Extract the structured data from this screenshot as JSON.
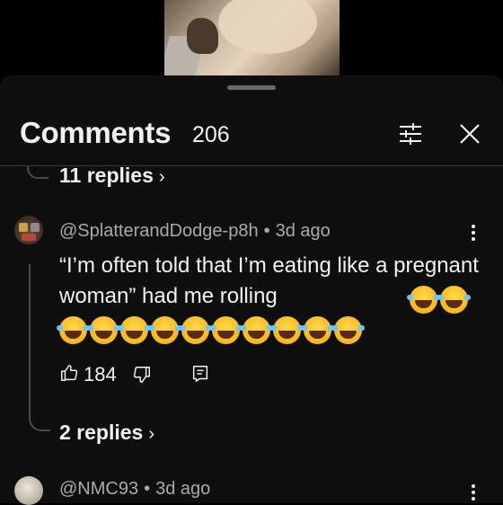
{
  "header": {
    "title": "Comments",
    "count": "206"
  },
  "thread_above": {
    "replies_label": "11 replies",
    "chevron": "›"
  },
  "comments": [
    {
      "author": "@SplatterandDodge-p8h",
      "time": "3d ago",
      "text": "“I’m often told that I’m eating like a pregnant woman” had me rolling",
      "emoji": "face-with-tears-of-joy",
      "emoji_total": 12,
      "likes": "184",
      "replies_label": "2 replies",
      "chevron": "›"
    },
    {
      "author": "@NMC93",
      "time": "3d ago"
    }
  ],
  "separator": "•",
  "icons": {
    "filter": "sliders-icon",
    "close": "close-icon",
    "like": "thumbs-up-icon",
    "dislike": "thumbs-down-icon",
    "reply": "reply-comment-icon",
    "more": "more-vert-icon"
  },
  "colors": {
    "background": "#0f0f0f",
    "text": "#f1f1f1",
    "secondary_text": "#aaaaaa",
    "emoji_yellow": "#f5b81e",
    "tear_blue": "#6fc5f5"
  }
}
